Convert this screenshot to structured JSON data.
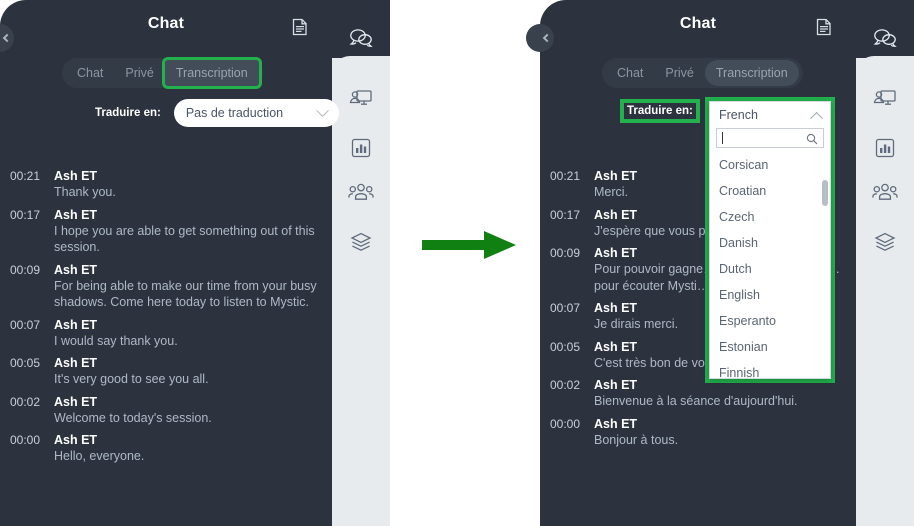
{
  "meta": {
    "accent_green": "#22b14c",
    "panel_bg": "#2c333e",
    "rail_bg": "#e8ebed"
  },
  "left_panel": {
    "header": {
      "title": "Chat",
      "doc_icon": "document-icon"
    },
    "tabs": [
      {
        "id": "chat",
        "label": "Chat",
        "active": false,
        "highlighted": false
      },
      {
        "id": "prive",
        "label": "Privé",
        "active": false,
        "highlighted": false
      },
      {
        "id": "transcription",
        "label": "Transcription",
        "active": true,
        "highlighted": true
      }
    ],
    "translate": {
      "label": "Traduire en:",
      "selected": "Pas de traduction",
      "chevron": "chevron-down-icon",
      "highlighted": false
    },
    "messages": [
      {
        "time": "00:21",
        "name": "Ash ET",
        "text": "Thank you."
      },
      {
        "time": "00:17",
        "name": "Ash ET",
        "text": "I hope you are able to get something out of this session."
      },
      {
        "time": "00:09",
        "name": "Ash ET",
        "text": "For being able to make our time from your busy shadows. Come here today to listen to Mystic."
      },
      {
        "time": "00:07",
        "name": "Ash ET",
        "text": "I would say thank you."
      },
      {
        "time": "00:05",
        "name": "Ash ET",
        "text": "It's very good to see you all."
      },
      {
        "time": "00:02",
        "name": "Ash ET",
        "text": "Welcome to today's session."
      },
      {
        "time": "00:00",
        "name": "Ash ET",
        "text": "Hello, everyone."
      }
    ]
  },
  "right_panel": {
    "header": {
      "title": "Chat",
      "doc_icon": "document-icon"
    },
    "tabs": [
      {
        "id": "chat",
        "label": "Chat",
        "active": false,
        "highlighted": false
      },
      {
        "id": "prive",
        "label": "Privé",
        "active": false,
        "highlighted": false
      },
      {
        "id": "transcription",
        "label": "Transcription",
        "active": true,
        "highlighted": false
      }
    ],
    "translate": {
      "label": "Traduire en:",
      "selected": "French",
      "chevron": "chevron-up-icon",
      "highlighted": true
    },
    "dropdown": {
      "open": true,
      "value": "French",
      "search_value": "",
      "search_placeholder": "",
      "search_icon": "search-icon",
      "options": [
        "Corsican",
        "Croatian",
        "Czech",
        "Danish",
        "Dutch",
        "English",
        "Esperanto",
        "Estonian",
        "Finnish"
      ]
    },
    "messages": [
      {
        "time": "00:21",
        "name": "Ash ET",
        "text": "Merci."
      },
      {
        "time": "00:17",
        "name": "Ash ET",
        "text": "J'espère que vous p… de cette session."
      },
      {
        "time": "00:09",
        "name": "Ash ET",
        "text": "Pour pouvoir gagne… vos ombres occupé… pour écouter Mysti…"
      },
      {
        "time": "00:07",
        "name": "Ash ET",
        "text": "Je dirais merci."
      },
      {
        "time": "00:05",
        "name": "Ash ET",
        "text": "C'est très bon de vous voir tous."
      },
      {
        "time": "00:02",
        "name": "Ash ET",
        "text": "Bienvenue à la séance d'aujourd'hui."
      },
      {
        "time": "00:00",
        "name": "Ash ET",
        "text": "Bonjour à tous."
      }
    ]
  },
  "rail_icons": [
    {
      "id": "chat",
      "name": "chat-bubbles-icon",
      "active": true
    },
    {
      "id": "screen-share",
      "name": "screen-share-icon",
      "active": false
    },
    {
      "id": "polls",
      "name": "bar-chart-icon",
      "active": false
    },
    {
      "id": "participants",
      "name": "participants-icon",
      "active": false
    },
    {
      "id": "layers",
      "name": "layers-icon",
      "active": false
    }
  ],
  "arrow": {
    "name": "green-right-arrow",
    "color": "#118012"
  }
}
